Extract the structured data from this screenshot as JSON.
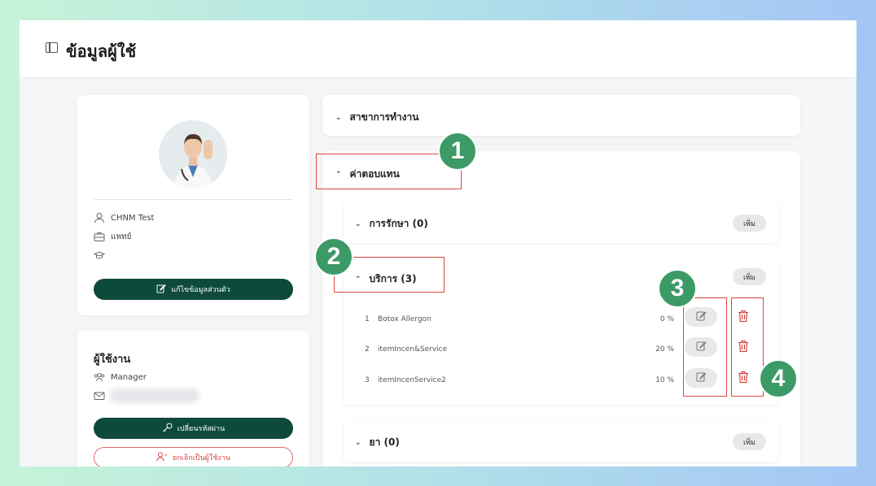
{
  "header": {
    "title": "ข้อมูลผู้ใช้"
  },
  "profile": {
    "name": "CHNM Test",
    "role": "แพทย์",
    "education": "",
    "edit_button": "แก้ไขข้อมูลส่วนตัว"
  },
  "user": {
    "title": "ผู้ใช้งาน",
    "permission": "Manager",
    "change_password_button": "เปลี่ยนรหัสผ่าน",
    "cancel_user_button": "ยกเลิกเป็นผู้ใช้งาน"
  },
  "branch_section": {
    "label": "สาขาการทำงาน"
  },
  "compensation": {
    "label": "ค่าตอบแทน",
    "add_label": "เพิ่ม",
    "treatment": {
      "label": "การรักษา (0)"
    },
    "service": {
      "label": "บริการ (3)",
      "items": [
        {
          "no": "1",
          "name": "Botox Allergon",
          "percent": "0 %"
        },
        {
          "no": "2",
          "name": "itemIncen&Service",
          "percent": "20 %"
        },
        {
          "no": "3",
          "name": "itemIncenService2",
          "percent": "10 %"
        }
      ]
    },
    "drug": {
      "label": "ยา (0)"
    }
  },
  "annotations": [
    "1",
    "2",
    "3",
    "4"
  ],
  "colors": {
    "primary": "#0e4a3c",
    "danger": "#d94444",
    "badge": "#3c9a67",
    "highlight": "#e0463c"
  }
}
